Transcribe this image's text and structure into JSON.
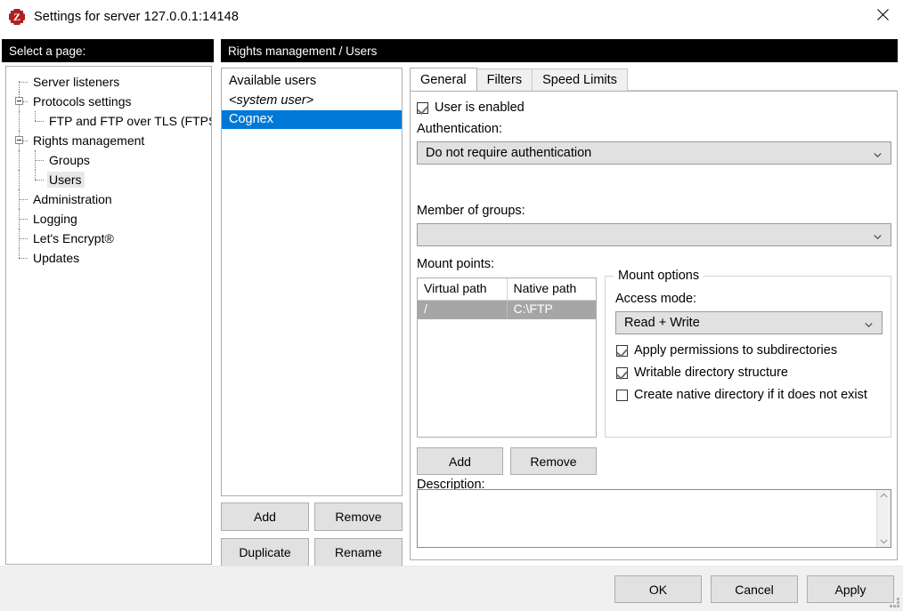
{
  "window": {
    "title": "Settings for server 127.0.0.1:14148",
    "icon": "filezilla-logo-icon",
    "close_label": "×"
  },
  "left_header": {
    "label": "Select a page:"
  },
  "right_header": {
    "label": "Rights management / Users"
  },
  "tree": {
    "items": [
      {
        "label": "Server listeners",
        "depth": 1,
        "expander": "none",
        "selected": false
      },
      {
        "label": "Protocols settings",
        "depth": 1,
        "expander": "expanded",
        "selected": false
      },
      {
        "label": "FTP and FTP over TLS (FTPS)",
        "depth": 2,
        "expander": "none",
        "selected": false
      },
      {
        "label": "Rights management",
        "depth": 1,
        "expander": "expanded",
        "selected": false
      },
      {
        "label": "Groups",
        "depth": 2,
        "expander": "none",
        "selected": false
      },
      {
        "label": "Users",
        "depth": 2,
        "expander": "none",
        "selected": true
      },
      {
        "label": "Administration",
        "depth": 1,
        "expander": "none",
        "selected": false
      },
      {
        "label": "Logging",
        "depth": 1,
        "expander": "none",
        "selected": false
      },
      {
        "label": "Let's Encrypt®",
        "depth": 1,
        "expander": "none",
        "selected": false
      },
      {
        "label": "Updates",
        "depth": 1,
        "expander": "none",
        "selected": false
      }
    ]
  },
  "users_panel": {
    "title": "Available users",
    "items": [
      {
        "label": "<system user>",
        "italic": true,
        "selected": false
      },
      {
        "label": "Cognex",
        "italic": false,
        "selected": true
      }
    ],
    "buttons": {
      "add": "Add",
      "remove": "Remove",
      "duplicate": "Duplicate",
      "rename": "Rename"
    }
  },
  "tabs": [
    {
      "label": "General",
      "active": true
    },
    {
      "label": "Filters",
      "active": false
    },
    {
      "label": "Speed Limits",
      "active": false
    }
  ],
  "general": {
    "user_enabled": {
      "label": "User is enabled",
      "checked": true
    },
    "authentication": {
      "label": "Authentication:",
      "value": "Do not require authentication"
    },
    "member_of_groups": {
      "label": "Member of groups:",
      "value": ""
    },
    "mount_points": {
      "label": "Mount points:",
      "columns": [
        "Virtual path",
        "Native path"
      ],
      "rows": [
        {
          "virtual_path": "/",
          "native_path": "C:\\FTP",
          "selected": true
        }
      ],
      "buttons": {
        "add": "Add",
        "remove": "Remove"
      }
    },
    "mount_options": {
      "title": "Mount options",
      "access_mode": {
        "label": "Access mode:",
        "value": "Read + Write"
      },
      "checkboxes": [
        {
          "label": "Apply permissions to subdirectories",
          "checked": true
        },
        {
          "label": "Writable directory structure",
          "checked": true
        },
        {
          "label": "Create native directory if it does not exist",
          "checked": false
        }
      ]
    },
    "description": {
      "label": "Description:",
      "value": ""
    }
  },
  "footer": {
    "ok": "OK",
    "cancel": "Cancel",
    "apply": "Apply"
  },
  "colors": {
    "selection_blue": "#0078d7",
    "header_black": "#000000",
    "button_face": "#e1e1e1",
    "row_selected_gray": "#a6a6a6",
    "logo_red": "#b02020"
  }
}
